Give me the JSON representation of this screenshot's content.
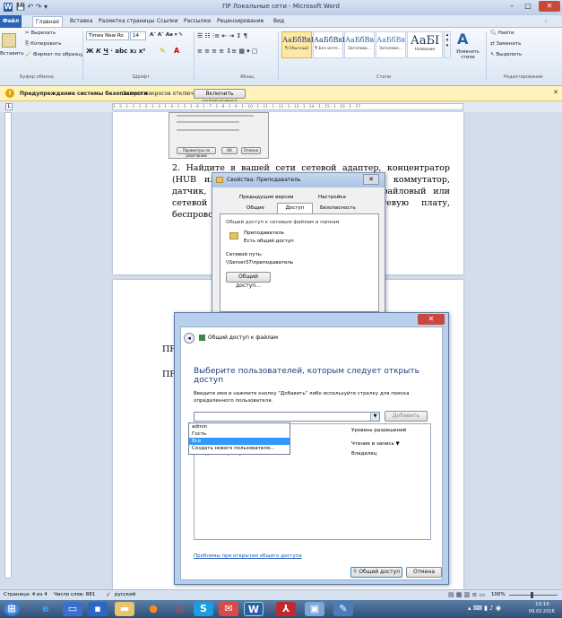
{
  "window": {
    "title": "ПР Локальные сети - Microsoft Word"
  },
  "ribbon_tabs": [
    "Файл",
    "Главная",
    "Вставка",
    "Разметка страницы",
    "Ссылки",
    "Рассылки",
    "Рецензирование",
    "Вид"
  ],
  "clipboard": {
    "cut": "Вырезать",
    "copy": "Копировать",
    "paste": "Вставить",
    "format": "Формат по образцу",
    "group": "Буфер обмена"
  },
  "font": {
    "name": "Times New Ro",
    "size": "14",
    "group": "Шрифт"
  },
  "paragraph": {
    "group": "Абзац"
  },
  "styles": {
    "items": [
      {
        "preview": "АаБбВвІ",
        "name": "¶ Обычный"
      },
      {
        "preview": "АаБбВвІ",
        "name": "¶ Без инте..."
      },
      {
        "preview": "АаБбВв",
        "name": "Заголово..."
      },
      {
        "preview": "АаБбВв",
        "name": "Заголово..."
      },
      {
        "preview": "АаБІ",
        "name": "Название"
      }
    ],
    "change": "Изменить стили",
    "group": "Стили"
  },
  "editing": {
    "find": "Найти",
    "replace": "Заменить",
    "select": "Выделить",
    "group": "Редактирование"
  },
  "security": {
    "warning": "Предупреждение системы безопасности",
    "message": "Запуск макросов отключен.",
    "button": "Включить содержимое"
  },
  "ruler": {
    "text": "1 · 2 · 1 · 1 · 1 · 2 · 1 · 3 · 1 · 4 · 1 · 5 · 1 · 6 · 1 · 7 · 1 · 8 · 1 · 9 · 1 · 10 · 1 · 11 · 1 · 12 · 1 · 13 · 1 · 14 · 1 · 15 · 1 · 16 · 1 · 17"
  },
  "thumb": {
    "ok": "ОК",
    "cancel": "Отмена",
    "settings": "Параметры по умолчанию"
  },
  "doc": {
    "para": "2. Найдите в вашей сети сетевой адаптер, концентратор (HUB или Switch), маршрутизатор, модем, коммутатор, датчик, Wi-Fi-роутер, игровую приставку, файловый или сетевой сервер, рабочую станцию (сетевую плату, беспроводной модуль). Пуск → Сеть",
    "l1": "ПР",
    "l2": "ПР"
  },
  "props": {
    "title": "Свойства: Преподаватель",
    "tabs": [
      "Предыдущие версии",
      "Настройка",
      "Общие",
      "Доступ",
      "Безопасность"
    ],
    "section": "Общий доступ к сетевым файлам и папкам",
    "folder": "Преподаватель",
    "shared": "Есть общий доступ",
    "pathlabel": "Сетевой путь:",
    "path": "\\\\Server37\\преподаватель",
    "sharebtn": "Общий доступ..."
  },
  "share": {
    "title": "Общий доступ к файлам",
    "heading": "Выберите пользователей, которым следует открыть доступ",
    "instruction": "Введите имя и нажмите кнопку \"Добавить\" либо используйте стрелку для поиска определенного пользователя.",
    "add": "Добавить",
    "options": [
      "admin",
      "Гость",
      "Все",
      "Создать нового пользователя..."
    ],
    "selected_index": 2,
    "col_level": "Уровень разрешений",
    "level": "Чтение и запись ▼",
    "owner_level": "Владелец",
    "owner": "Администраторы",
    "problems": "Проблемы при открытии общего доступа",
    "share_btn": "Общий доступ",
    "cancel": "Отмена"
  },
  "status": {
    "page": "Страница: 4 из 4",
    "words": "Число слов: 881",
    "lang": "русский",
    "zoom": "100%"
  },
  "taskbar": {
    "time": "10:16",
    "date": "09.02.2016"
  }
}
